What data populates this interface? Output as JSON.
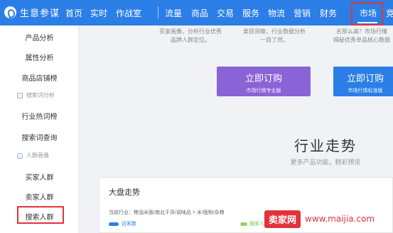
{
  "topbar": {
    "brand": "生意参谋",
    "nav": [
      "首页",
      "实时",
      "作战室",
      "流量",
      "商品",
      "交易",
      "服务",
      "物流",
      "营销",
      "财务",
      "市场",
      "竞"
    ]
  },
  "sidebar": {
    "items_top": [
      "产品分析",
      "属性分析",
      "商品店铺榜"
    ],
    "section1": "搜索词分析",
    "items_mid": [
      "行业热词榜",
      "搜索词查询"
    ],
    "section2": "人群画像",
    "items_bottom": [
      "买家人群",
      "卖家人群",
      "搜索人群"
    ]
  },
  "banner": {
    "left_line1": "买家画像，分析行业优秀",
    "left_line2": "品牌人群定位。",
    "mid_line1": "类目洞察，行业数据分析",
    "mid_line2": "一目了然。",
    "right_line1": "名那么高？市场行情",
    "right_line2": "揭秘优秀单品核心数据"
  },
  "buttons": {
    "purple_main": "立即订购",
    "purple_sub": "市场行情专业版",
    "blue_main": "立即订购",
    "blue_sub": "市场行情标准版"
  },
  "trend": {
    "title": "行业走势",
    "subtitle": "更多产品功能，精彩预览"
  },
  "panel": {
    "title": "大盘走势",
    "crumb": "当前行业：粮油米面/南北干货/调味品 > 米/面粉/杂粮",
    "legend1": "访客数",
    "legend2": "搜索人气"
  },
  "watermark": {
    "badge": "卖家网",
    "url": "www.maijia.com"
  },
  "colors": {
    "primary": "#2b7ee6",
    "purple": "#8a63d6",
    "highlight": "#e0343a",
    "legend_green": "#9bd06a"
  }
}
